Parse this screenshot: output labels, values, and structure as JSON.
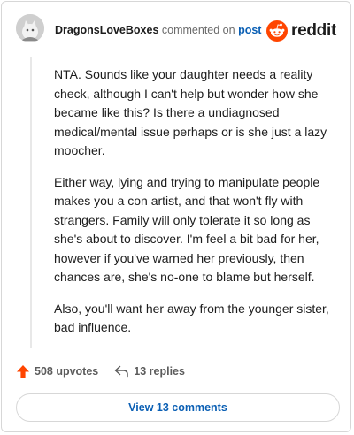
{
  "comment": {
    "author": "DragonsLoveBoxes",
    "action_text": "commented on",
    "target_link": "post",
    "paragraphs": [
      "NTA. Sounds like your daughter needs a reality check, although I can't help but wonder how she became like this? Is there a undiagnosed medical/mental issue perhaps or is she just a lazy moocher.",
      "Either way, lying and trying to manipulate people makes you a con artist, and that won't fly with strangers. Family will only tolerate it so long as she's about to discover. I'm feel a bit bad for her, however if you've warned her previously, then chances are, she's no-one to blame but herself.",
      "Also, you'll want her away from the younger sister, bad influence."
    ]
  },
  "brand": {
    "name": "reddit",
    "accent": "#ff4500"
  },
  "stats": {
    "upvotes": "508 upvotes",
    "replies": "13 replies"
  },
  "footer": {
    "view_comments_label": "View 13 comments"
  },
  "icons": {
    "avatar": "cat-avatar",
    "logo": "reddit-snoo-icon",
    "upvote": "upvote-arrow-icon",
    "reply": "reply-arrow-icon"
  },
  "colors": {
    "link": "#0a5fb4",
    "upvote": "#ff4500",
    "muted": "#6a6a6a"
  }
}
